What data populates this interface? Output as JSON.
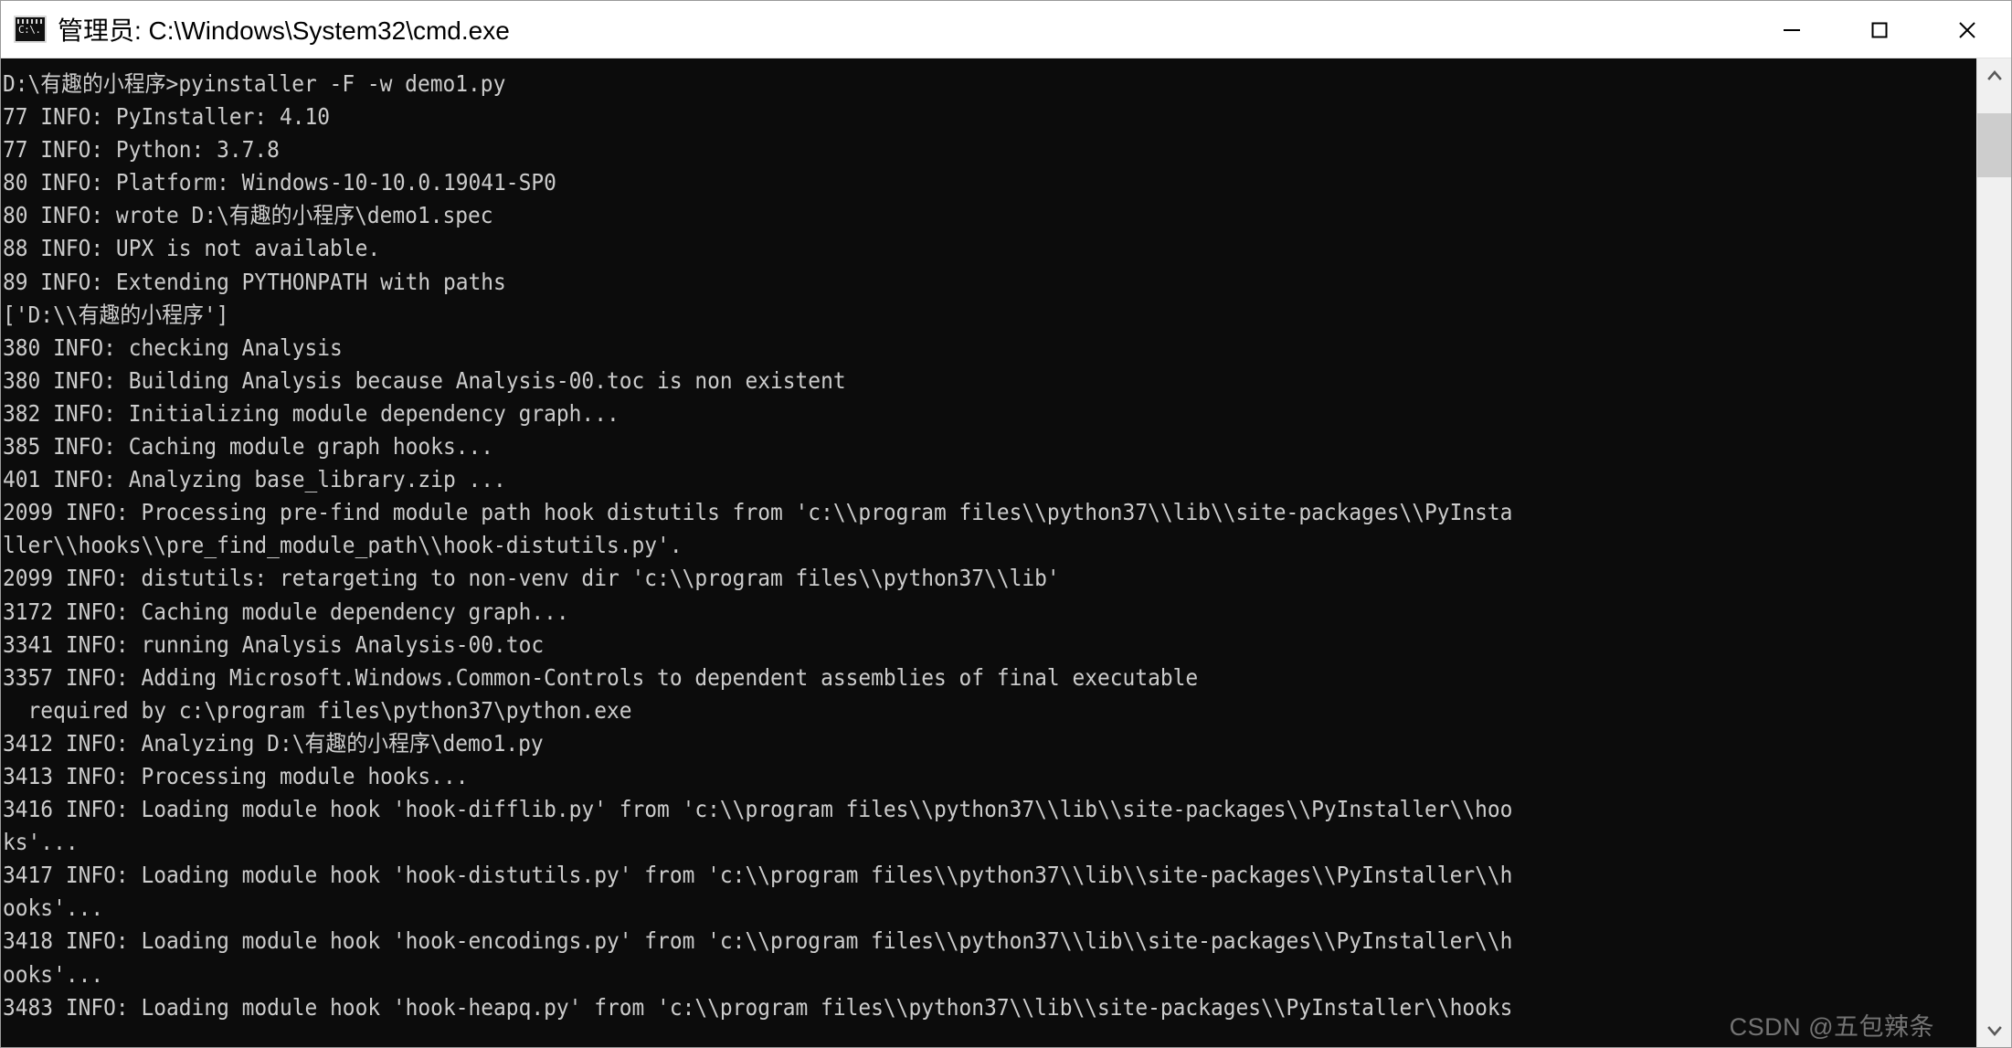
{
  "window": {
    "title": "管理员: C:\\Windows\\System32\\cmd.exe",
    "icon": "cmd-console-icon",
    "controls": {
      "minimize_label": "最小化",
      "maximize_label": "最大化",
      "close_label": "关闭"
    },
    "colors": {
      "titlebar_background": "#ffffff",
      "titlebar_text": "#000000",
      "console_background": "#0c0c0c",
      "console_text": "#cccccc",
      "scrollbar_track": "#f0f0f0",
      "scrollbar_thumb": "#cdcdcd"
    }
  },
  "console": {
    "prompt_line": "D:\\有趣的小程序>pyinstaller -F -w demo1.py",
    "lines": [
      "D:\\有趣的小程序>pyinstaller -F -w demo1.py",
      "77 INFO: PyInstaller: 4.10",
      "77 INFO: Python: 3.7.8",
      "80 INFO: Platform: Windows-10-10.0.19041-SP0",
      "80 INFO: wrote D:\\有趣的小程序\\demo1.spec",
      "88 INFO: UPX is not available.",
      "89 INFO: Extending PYTHONPATH with paths",
      "['D:\\\\有趣的小程序']",
      "380 INFO: checking Analysis",
      "380 INFO: Building Analysis because Analysis-00.toc is non existent",
      "382 INFO: Initializing module dependency graph...",
      "385 INFO: Caching module graph hooks...",
      "401 INFO: Analyzing base_library.zip ...",
      "2099 INFO: Processing pre-find module path hook distutils from 'c:\\\\program files\\\\python37\\\\lib\\\\site-packages\\\\PyInsta",
      "ller\\\\hooks\\\\pre_find_module_path\\\\hook-distutils.py'.",
      "2099 INFO: distutils: retargeting to non-venv dir 'c:\\\\program files\\\\python37\\\\lib'",
      "3172 INFO: Caching module dependency graph...",
      "3341 INFO: running Analysis Analysis-00.toc",
      "3357 INFO: Adding Microsoft.Windows.Common-Controls to dependent assemblies of final executable",
      "  required by c:\\program files\\python37\\python.exe",
      "3412 INFO: Analyzing D:\\有趣的小程序\\demo1.py",
      "3413 INFO: Processing module hooks...",
      "3416 INFO: Loading module hook 'hook-difflib.py' from 'c:\\\\program files\\\\python37\\\\lib\\\\site-packages\\\\PyInstaller\\\\hoo",
      "ks'...",
      "3417 INFO: Loading module hook 'hook-distutils.py' from 'c:\\\\program files\\\\python37\\\\lib\\\\site-packages\\\\PyInstaller\\\\h",
      "ooks'...",
      "3418 INFO: Loading module hook 'hook-encodings.py' from 'c:\\\\program files\\\\python37\\\\lib\\\\site-packages\\\\PyInstaller\\\\h",
      "ooks'...",
      "3483 INFO: Loading module hook 'hook-heapq.py' from 'c:\\\\program files\\\\python37\\\\lib\\\\site-packages\\\\PyInstaller\\\\hooks"
    ]
  },
  "scrollbar": {
    "up_arrow": "chevron-up-icon",
    "down_arrow": "chevron-down-icon"
  },
  "watermark": {
    "text": "CSDN @五包辣条"
  }
}
